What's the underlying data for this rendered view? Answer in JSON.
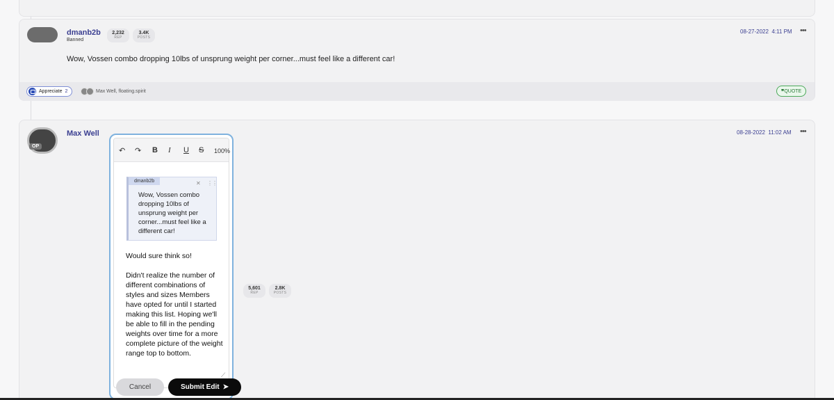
{
  "post1": {
    "username": "dmanb2b",
    "role": "Banned",
    "rep_value": "2,232",
    "rep_label": "REP",
    "posts_value": "3.4K",
    "posts_label": "POSTS",
    "date": "08-27-2022",
    "time": "4:11 PM",
    "more_icon": "ellipsis-icon",
    "body": "Wow, Vossen combo dropping 10lbs of unsprung weight per corner...must feel like a different car!",
    "appreciate_label": "Appreciate",
    "appreciate_count": "2",
    "reactors": "Max Well, floating.spirit",
    "quote_label": "QUOTE"
  },
  "post2": {
    "username": "Max Well",
    "op_badge": "OP",
    "rep_value": "5,601",
    "rep_label": "REP",
    "posts_value": "2.8K",
    "posts_label": "POSTS",
    "date": "08-28-2022",
    "time": "11:02 AM"
  },
  "editor": {
    "undo_icon": "undo-icon",
    "redo_icon": "redo-icon",
    "bold": "B",
    "italic": "I",
    "underline": "U",
    "strike": "S",
    "zoom": "100%",
    "quote_author": "dmanb2b",
    "quote_text": "Wow, Vossen combo dropping 10lbs of unsprung weight per corner...must feel like a different car!",
    "para1": "Would sure think so!",
    "para2": "Didn't realize the number of different combinations of styles and sizes Members have opted for until I started making this list. Hoping we'll be able to fill in the pending weights over time for a more complete picture of the weight range top to bottom."
  },
  "buttons": {
    "cancel": "Cancel",
    "submit": "Submit Edit"
  },
  "colors": {
    "username": "#3b3f91",
    "quote_green": "#4ca85a",
    "editor_border": "#7fb2de",
    "submit_bg": "#0b0b0b"
  }
}
